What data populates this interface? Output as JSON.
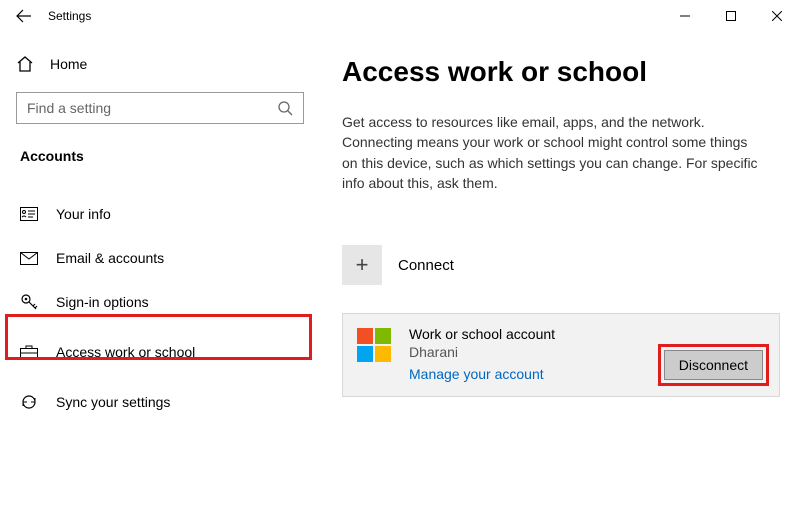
{
  "titlebar": {
    "app_title": "Settings"
  },
  "sidebar": {
    "home_label": "Home",
    "search_placeholder": "Find a setting",
    "section": "Accounts",
    "items": [
      {
        "label": "Your info"
      },
      {
        "label": "Email & accounts"
      },
      {
        "label": "Sign-in options"
      },
      {
        "label": "Access work or school"
      },
      {
        "label": "Sync your settings"
      }
    ]
  },
  "main": {
    "heading": "Access work or school",
    "description": "Get access to resources like email, apps, and the network. Connecting means your work or school might control some things on this device, such as which settings you can change. For specific info about this, ask them.",
    "connect_label": "Connect",
    "account": {
      "title": "Work or school account",
      "name": "Dharani",
      "manage_link": "Manage your account",
      "disconnect_label": "Disconnect"
    }
  }
}
